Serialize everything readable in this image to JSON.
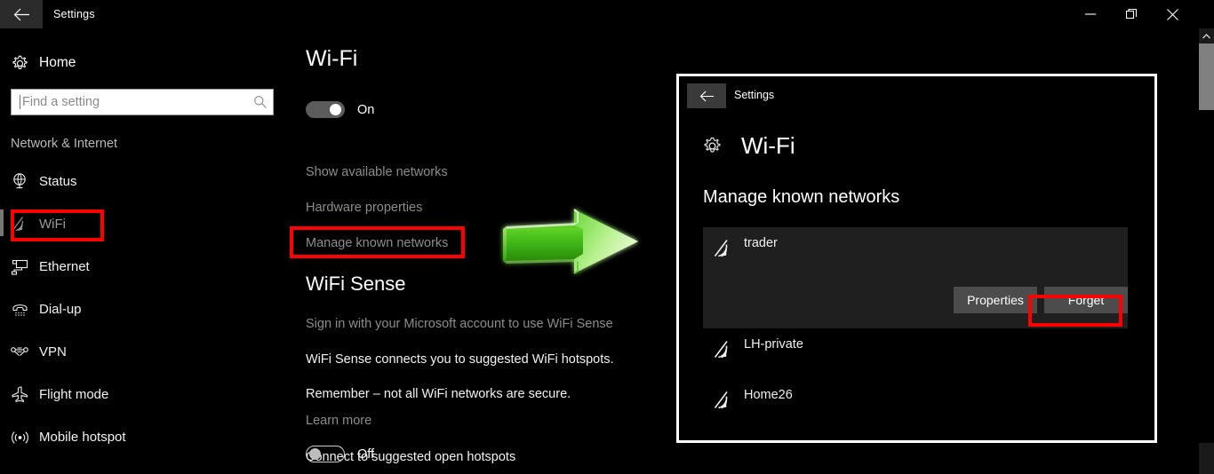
{
  "window": {
    "title": "Settings",
    "back_icon": "arrow-left-icon",
    "controls": {
      "minimize": "minimize-icon",
      "maximize": "restore-icon",
      "close": "close-icon"
    }
  },
  "sidebar": {
    "home": {
      "label": "Home",
      "icon": "gear-icon"
    },
    "search": {
      "placeholder": "Find a setting",
      "value": "",
      "icon": "search-icon"
    },
    "section_title": "Network & Internet",
    "items": [
      {
        "label": "Status",
        "icon": "globe-icon",
        "selected": false
      },
      {
        "label": "WiFi",
        "icon": "wifi-icon",
        "selected": true,
        "highlighted": true
      },
      {
        "label": "Ethernet",
        "icon": "ethernet-icon",
        "selected": false
      },
      {
        "label": "Dial-up",
        "icon": "phone-icon",
        "selected": false
      },
      {
        "label": "VPN",
        "icon": "vpn-icon",
        "selected": false
      },
      {
        "label": "Flight mode",
        "icon": "airplane-icon",
        "selected": false
      },
      {
        "label": "Mobile hotspot",
        "icon": "hotspot-icon",
        "selected": false
      }
    ]
  },
  "main": {
    "heading": "Wi-Fi",
    "wifi_toggle": {
      "state": "On",
      "label": "On"
    },
    "links": [
      "Show available networks",
      "Hardware properties",
      "Manage known networks"
    ],
    "highlighted_link": "Manage known networks",
    "sense": {
      "heading": "WiFi Sense",
      "signin": "Sign in with your Microsoft account to use WiFi Sense",
      "line1": "WiFi Sense connects you to suggested WiFi hotspots.",
      "line2": "Remember – not all WiFi networks are secure.",
      "learn_more": "Learn more",
      "hotspot_label": "Connect to suggested open hotspots",
      "hotspot_toggle": {
        "state": "Off",
        "label": "Off"
      }
    },
    "arrow": {
      "icon": "green-arrow-right-icon",
      "color": "#3fc21a"
    }
  },
  "inset": {
    "titlebar": {
      "title": "Settings",
      "back_icon": "arrow-left-icon"
    },
    "heading": "Wi-Fi",
    "heading_icon": "gear-icon",
    "subheading": "Manage known networks",
    "networks": [
      {
        "name": "trader",
        "icon": "wifi-icon",
        "expanded": true,
        "buttons": [
          {
            "label": "Properties",
            "highlighted": false
          },
          {
            "label": "Forget",
            "highlighted": true
          }
        ]
      },
      {
        "name": "LH-private",
        "icon": "wifi-icon",
        "expanded": false,
        "buttons": []
      },
      {
        "name": "Home26",
        "icon": "wifi-icon",
        "expanded": false,
        "buttons": []
      }
    ]
  },
  "scrollbar": {
    "up_icon": "chevron-up-icon"
  },
  "colors": {
    "highlight_red": "#ff0000",
    "arrow_green": "#3fc21a",
    "accent_grey": "#4c4c4c",
    "background": "#000000"
  }
}
